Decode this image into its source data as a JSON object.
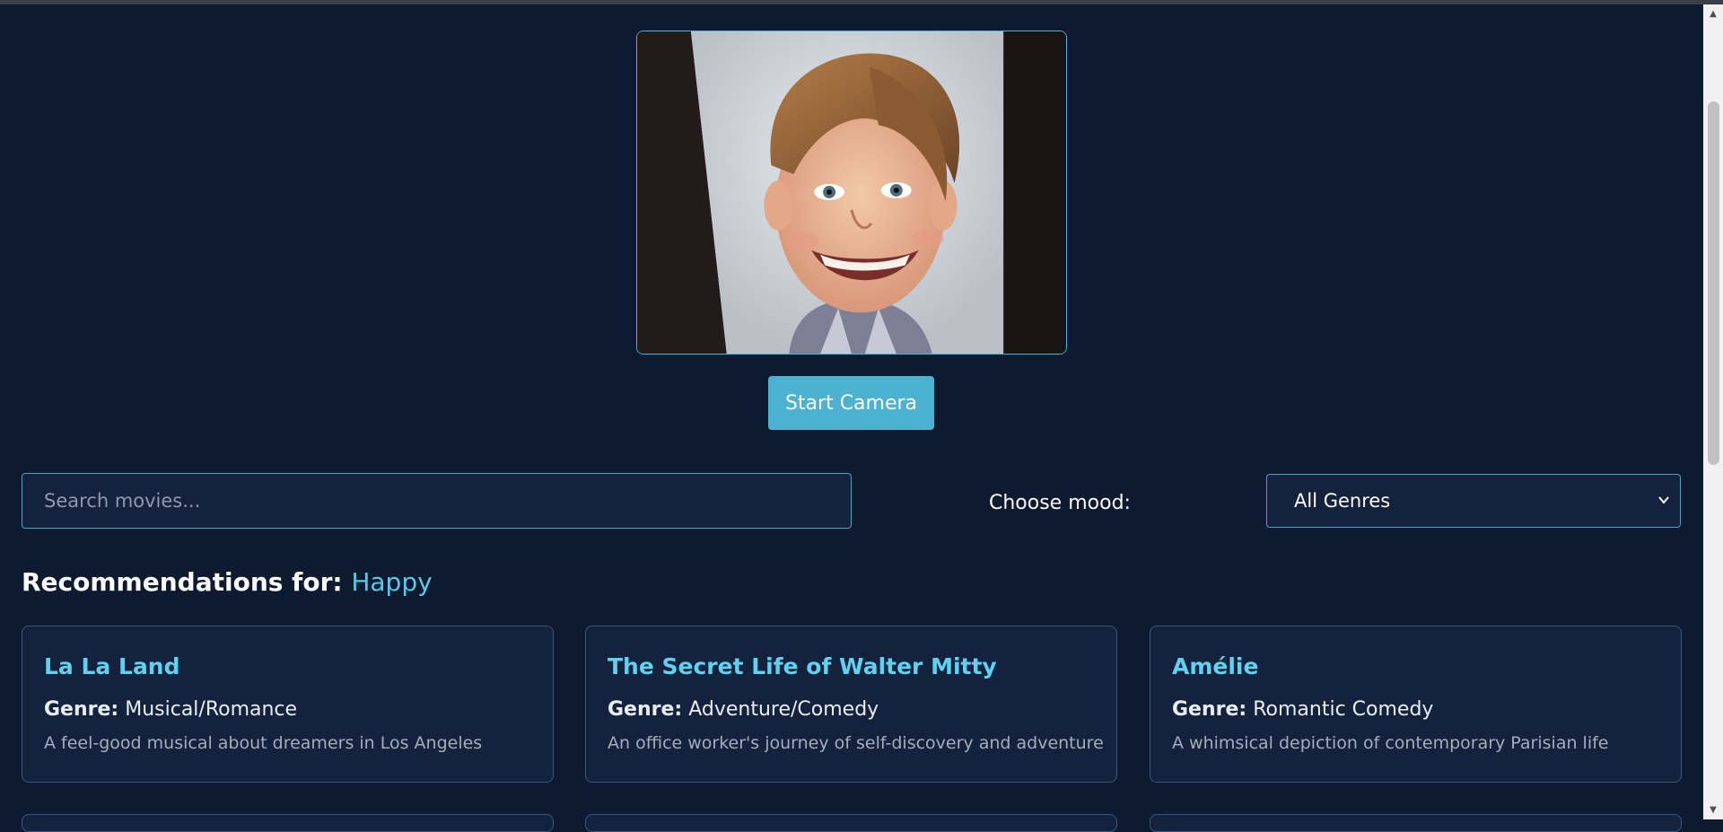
{
  "camera": {
    "button_label": "Start Camera"
  },
  "search": {
    "placeholder": "Search movies..."
  },
  "mood_filter": {
    "label": "Choose mood:",
    "selected": "All Genres"
  },
  "recommendations": {
    "heading": "Recommendations for:",
    "mood": "Happy",
    "genre_prefix": "Genre:",
    "movies": [
      {
        "title": "La La Land",
        "genre": "Musical/Romance",
        "description": "A feel-good musical about dreamers in Los Angeles"
      },
      {
        "title": "The Secret Life of Walter Mitty",
        "genre": "Adventure/Comedy",
        "description": "An office worker's journey of self-discovery and adventure"
      },
      {
        "title": "Amélie",
        "genre": "Romantic Comedy",
        "description": "A whimsical depiction of contemporary Parisian life"
      }
    ]
  },
  "colors": {
    "background": "#0e1a2f",
    "accent": "#4cb2cf",
    "card_title": "#5fd2f2",
    "mood_highlight": "#5cc7e8"
  },
  "icons": {
    "select_arrow": "chevron-down-icon",
    "scroll_up": "scroll-up-arrow-icon",
    "scroll_down": "scroll-down-arrow-icon"
  }
}
